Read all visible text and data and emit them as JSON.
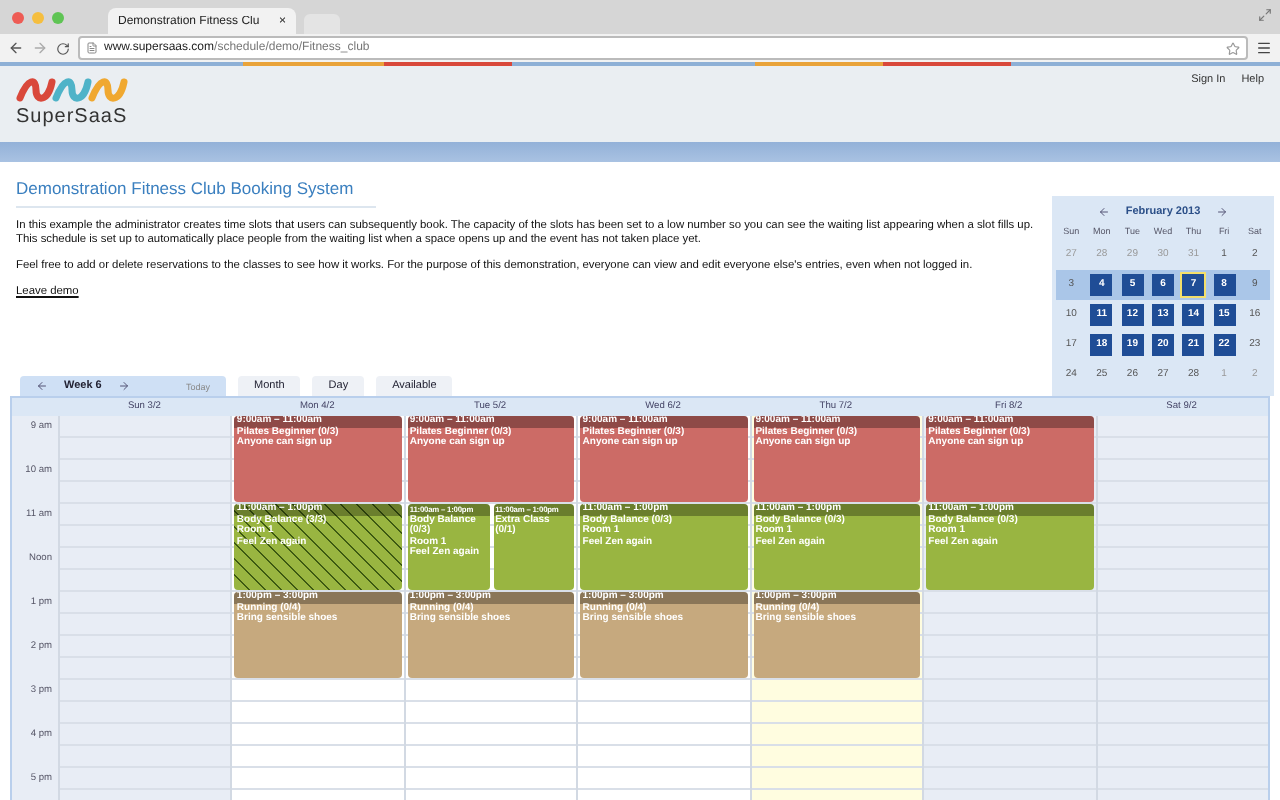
{
  "browser": {
    "tab_title": "Demonstration Fitness Clu",
    "tab_close": "×",
    "url_host": "www.supersaas.com",
    "url_path": "/schedule/demo/Fitness_club"
  },
  "header": {
    "logo": "SuperSaaS",
    "links": [
      "Sign In",
      "Help"
    ]
  },
  "intro": {
    "title": "Demonstration Fitness Club Booking System",
    "paragraphs": [
      "In this example the administrator creates time slots that users can subsequently book. The capacity of the slots has been set to a low number so you can see the waiting list appearing when a slot fills up. This schedule is set up to automatically place people from the waiting list when a space opens up and the event has not taken place yet.",
      "Feel free to add or delete reservations to the classes to see how it works. For the purpose of this demonstration, everyone can view and edit everyone else's entries, even when not logged in."
    ],
    "link": "Leave demo"
  },
  "views": [
    {
      "kind": "week",
      "label": "Week 6",
      "today": "Today",
      "selected": true
    },
    {
      "kind": "plain",
      "label": "Month",
      "selected": false
    },
    {
      "kind": "plain",
      "label": "Day",
      "selected": false
    },
    {
      "kind": "plain",
      "label": "Available",
      "selected": false
    }
  ],
  "mini_calendar": {
    "title": "February 2013",
    "weekdays": [
      "Sun",
      "Mon",
      "Tue",
      "Wed",
      "Thu",
      "Fri",
      "Sat"
    ],
    "weeks": [
      {
        "selected": false,
        "days": [
          {
            "label": "27",
            "kind": "muted"
          },
          {
            "label": "28",
            "kind": "muted"
          },
          {
            "label": "29",
            "kind": "muted"
          },
          {
            "label": "30",
            "kind": "muted"
          },
          {
            "label": "31",
            "kind": "muted"
          },
          {
            "label": "1",
            "kind": "plain"
          },
          {
            "label": "2",
            "kind": "plain"
          }
        ]
      },
      {
        "selected": true,
        "days": [
          {
            "label": "3",
            "kind": "plain"
          },
          {
            "label": "4",
            "kind": "available"
          },
          {
            "label": "5",
            "kind": "available"
          },
          {
            "label": "6",
            "kind": "available"
          },
          {
            "label": "7",
            "kind": "today"
          },
          {
            "label": "8",
            "kind": "available"
          },
          {
            "label": "9",
            "kind": "plain"
          }
        ]
      },
      {
        "selected": false,
        "days": [
          {
            "label": "10",
            "kind": "plain"
          },
          {
            "label": "11",
            "kind": "available"
          },
          {
            "label": "12",
            "kind": "available"
          },
          {
            "label": "13",
            "kind": "available"
          },
          {
            "label": "14",
            "kind": "available"
          },
          {
            "label": "15",
            "kind": "available"
          },
          {
            "label": "16",
            "kind": "plain"
          }
        ]
      },
      {
        "selected": false,
        "days": [
          {
            "label": "17",
            "kind": "plain"
          },
          {
            "label": "18",
            "kind": "available"
          },
          {
            "label": "19",
            "kind": "available"
          },
          {
            "label": "20",
            "kind": "available"
          },
          {
            "label": "21",
            "kind": "available"
          },
          {
            "label": "22",
            "kind": "available"
          },
          {
            "label": "23",
            "kind": "plain"
          }
        ]
      },
      {
        "selected": false,
        "days": [
          {
            "label": "24",
            "kind": "plain"
          },
          {
            "label": "25",
            "kind": "plain"
          },
          {
            "label": "26",
            "kind": "plain"
          },
          {
            "label": "27",
            "kind": "plain"
          },
          {
            "label": "28",
            "kind": "plain"
          },
          {
            "label": "1",
            "kind": "muted"
          },
          {
            "label": "2",
            "kind": "muted"
          }
        ]
      }
    ]
  },
  "schedule": {
    "hours": [
      "9 am",
      "10 am",
      "11 am",
      "Noon",
      "1 pm",
      "2 pm",
      "3 pm",
      "4 pm",
      "5 pm"
    ],
    "days": [
      {
        "label": "Sun 3/2",
        "kind": "closed"
      },
      {
        "label": "Mon 4/2",
        "kind": "open",
        "events": [
          {
            "kind": "morning",
            "color": "#cc6b66",
            "full": false,
            "time": "9:00am – 11:00am",
            "title": "Pilates Beginner (0/3)",
            "lines": [
              "Anyone can sign up"
            ]
          },
          {
            "kind": "midday",
            "color": "#99b541",
            "full": true,
            "time": "11:00am – 1:00pm",
            "title": "Body Balance (3/3)",
            "lines": [
              "Room 1",
              "Feel Zen again"
            ]
          },
          {
            "kind": "afternoon",
            "color": "#c6a97e",
            "full": false,
            "time": "1:00pm – 3:00pm",
            "title": "Running (0/4)",
            "lines": [
              "Bring sensible shoes"
            ]
          }
        ]
      },
      {
        "label": "Tue 5/2",
        "kind": "open",
        "events": [
          {
            "kind": "morning",
            "color": "#cc6b66",
            "full": false,
            "time": "9:00am – 11:00am",
            "title": "Pilates Beginner (0/3)",
            "lines": [
              "Anyone can sign up"
            ]
          },
          {
            "kind": "midday",
            "color": "#99b541",
            "full": false,
            "time": "11:00am – 1:00pm",
            "title": "Body Balance (0/3)",
            "lines": [
              "Room 1",
              "Feel Zen again"
            ]
          },
          {
            "kind": "midday",
            "color": "#99b541",
            "full": false,
            "time": "11:00am – 1:00pm",
            "title": "Extra Class (0/1)"
          },
          {
            "kind": "afternoon",
            "color": "#c6a97e",
            "full": false,
            "time": "1:00pm – 3:00pm",
            "title": "Running (0/4)",
            "lines": [
              "Bring sensible shoes"
            ]
          }
        ]
      },
      {
        "label": "Wed 6/2",
        "kind": "open",
        "events": [
          {
            "kind": "morning",
            "color": "#cc6b66",
            "full": false,
            "time": "9:00am – 11:00am",
            "title": "Pilates Beginner (0/3)",
            "lines": [
              "Anyone can sign up"
            ]
          },
          {
            "kind": "midday",
            "color": "#99b541",
            "full": false,
            "time": "11:00am – 1:00pm",
            "title": "Body Balance (0/3)",
            "lines": [
              "Room 1",
              "Feel Zen again"
            ]
          },
          {
            "kind": "afternoon",
            "color": "#c6a97e",
            "full": false,
            "time": "1:00pm – 3:00pm",
            "title": "Running (0/4)",
            "lines": [
              "Bring sensible shoes"
            ]
          }
        ]
      },
      {
        "label": "Thu 7/2",
        "kind": "today",
        "events": [
          {
            "kind": "morning",
            "color": "#cc6b66",
            "full": false,
            "time": "9:00am – 11:00am",
            "title": "Pilates Beginner (0/3)",
            "lines": [
              "Anyone can sign up"
            ]
          },
          {
            "kind": "midday",
            "color": "#99b541",
            "full": false,
            "time": "11:00am – 1:00pm",
            "title": "Body Balance (0/3)",
            "lines": [
              "Room 1",
              "Feel Zen again"
            ]
          },
          {
            "kind": "afternoon",
            "color": "#c6a97e",
            "full": false,
            "time": "1:00pm – 3:00pm",
            "title": "Running (0/4)",
            "lines": [
              "Bring sensible shoes"
            ]
          }
        ]
      },
      {
        "label": "Fri 8/2",
        "kind": "closed",
        "events": [
          {
            "kind": "morning",
            "color": "#cc6b66",
            "full": false,
            "time": "9:00am – 11:00am",
            "title": "Pilates Beginner (0/3)",
            "lines": [
              "Anyone can sign up"
            ]
          },
          {
            "kind": "midday",
            "color": "#99b541",
            "full": false,
            "time": "11:00am – 1:00pm",
            "title": "Body Balance (0/3)",
            "lines": [
              "Room 1",
              "Feel Zen again"
            ]
          }
        ]
      },
      {
        "label": "Sat 9/2",
        "kind": "closed"
      }
    ]
  }
}
